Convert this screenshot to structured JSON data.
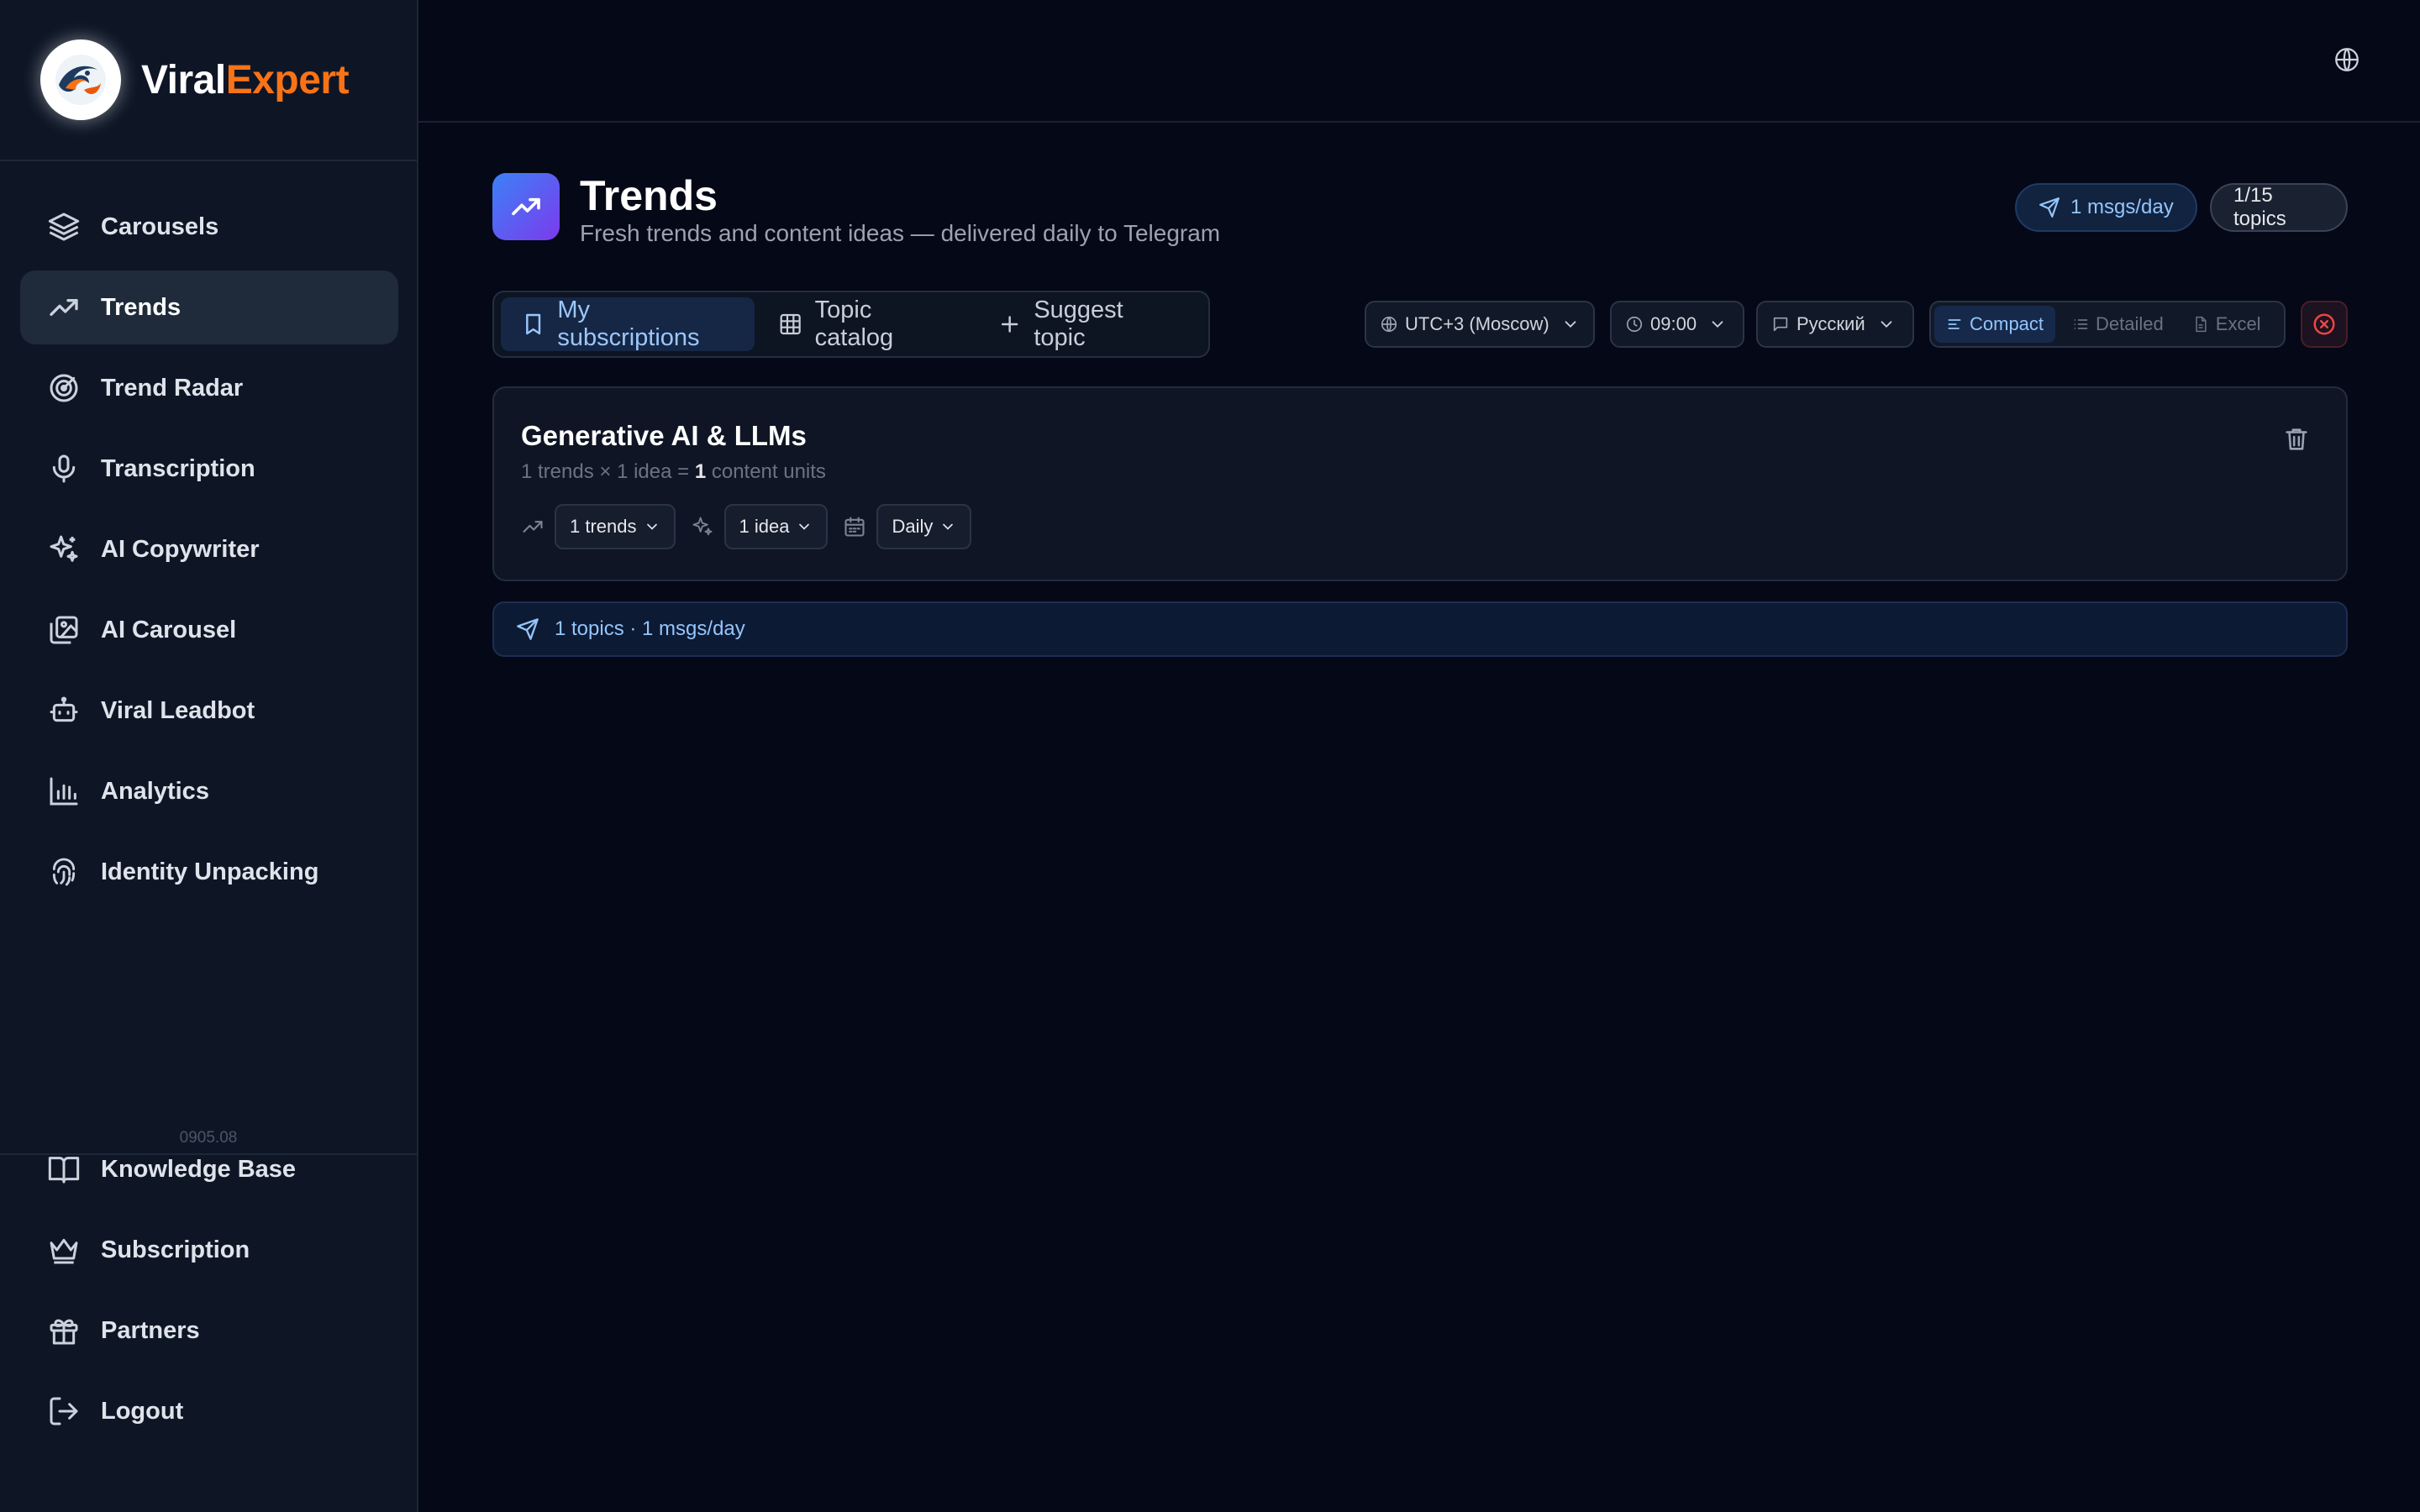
{
  "brand": {
    "name_part1": "Viral",
    "name_part2": "Expert",
    "accent_color": "#f97316"
  },
  "sidebar": {
    "items": [
      {
        "label": "Carousels",
        "icon": "layers-icon"
      },
      {
        "label": "Trends",
        "icon": "trending-up-icon",
        "active": true
      },
      {
        "label": "Trend Radar",
        "icon": "radar-icon"
      },
      {
        "label": "Transcription",
        "icon": "microphone-icon"
      },
      {
        "label": "AI Copywriter",
        "icon": "sparkles-icon"
      },
      {
        "label": "AI Carousel",
        "icon": "images-icon"
      },
      {
        "label": "Viral Leadbot",
        "icon": "bot-icon"
      },
      {
        "label": "Analytics",
        "icon": "bar-chart-icon"
      },
      {
        "label": "Identity Unpacking",
        "icon": "fingerprint-icon"
      }
    ],
    "version": "0905.08",
    "bottom_items": [
      {
        "label": "Knowledge Base",
        "icon": "book-icon"
      },
      {
        "label": "Subscription",
        "icon": "crown-icon"
      },
      {
        "label": "Partners",
        "icon": "gift-icon"
      },
      {
        "label": "Logout",
        "icon": "logout-icon"
      }
    ]
  },
  "header": {
    "title": "Trends",
    "subtitle": "Fresh trends and content ideas — delivered daily to Telegram",
    "msgs_pill": "1 msgs/day",
    "topics_pill": "1/15 topics"
  },
  "tabs": [
    {
      "label": "My subscriptions",
      "icon": "bookmark-icon",
      "active": true
    },
    {
      "label": "Topic catalog",
      "icon": "grid-icon"
    },
    {
      "label": "Suggest topic",
      "icon": "plus-icon"
    }
  ],
  "filters": {
    "timezone": "UTC+3 (Moscow)",
    "time": "09:00",
    "language": "Русский"
  },
  "view_modes": [
    {
      "label": "Compact",
      "icon": "align-left-icon",
      "active": true
    },
    {
      "label": "Detailed",
      "icon": "list-icon"
    },
    {
      "label": "Excel",
      "icon": "file-icon"
    }
  ],
  "subscription": {
    "title": "Generative AI & LLMs",
    "meta_prefix": "1 trends × 1 idea = ",
    "meta_count": "1",
    "meta_suffix": " content units",
    "trends_select": "1 trends",
    "ideas_select": "1 idea",
    "frequency_select": "Daily"
  },
  "summary": {
    "text": "1 topics · 1 msgs/day"
  },
  "colors": {
    "background": "#050816",
    "sidebar": "#0e1626",
    "accent_blue": "#93c5fd",
    "danger": "#ef4444"
  }
}
